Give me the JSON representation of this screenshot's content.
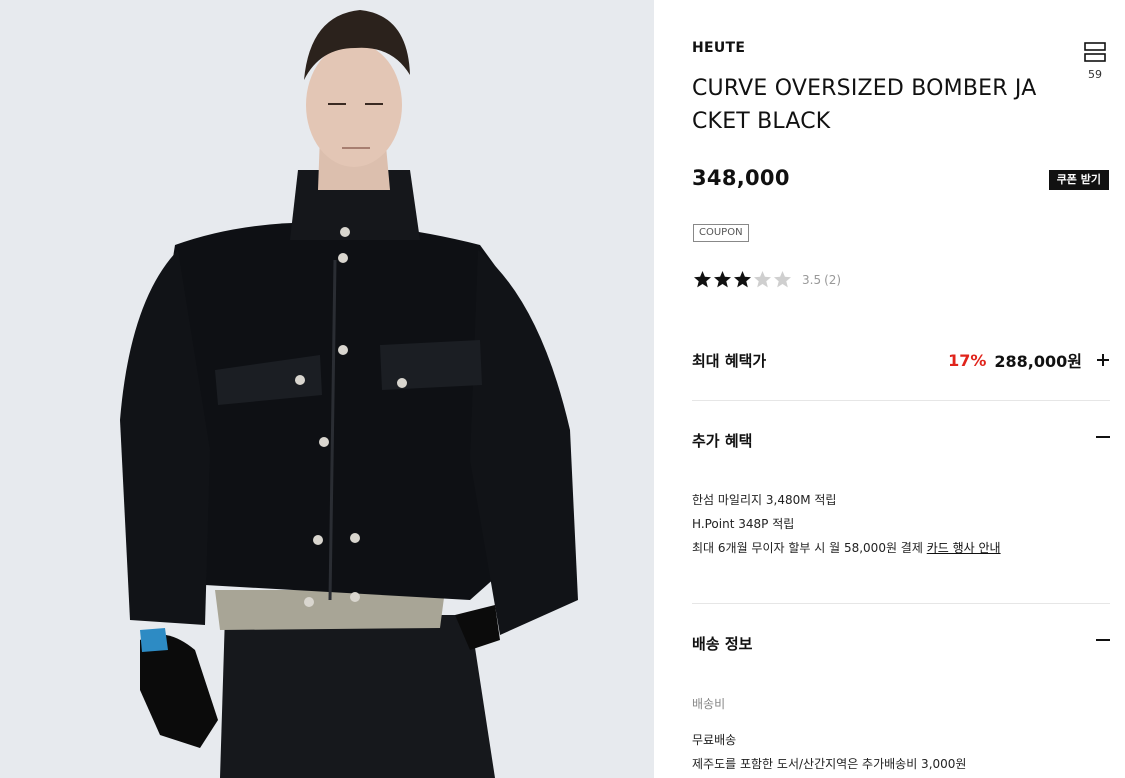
{
  "product": {
    "brand": "HEUTE",
    "title": "CURVE OVERSIZED BOMBER JACKET BLACK",
    "price": "348,000",
    "coupon_button": "쿠폰 받기",
    "coupon_badge": "COUPON",
    "bookmark_count": "59",
    "rating": {
      "score": "3.5",
      "count": "(2)",
      "stars_filled": 3,
      "stars_total": 5
    }
  },
  "max_benefit": {
    "label": "최대 혜택가",
    "discount": "17%",
    "price": "288,000원"
  },
  "extra_benefit": {
    "label": "추가 혜택",
    "lines": [
      "한섬 마일리지 3,480M 적립",
      "H.Point 348P 적립"
    ],
    "installment_text": "최대 6개월 무이자 할부 시 월 58,000원 결제",
    "installment_link": "카드 행사 안내"
  },
  "shipping": {
    "label": "배송 정보",
    "fee_label": "배송비",
    "free": "무료배송",
    "extra": "제주도를 포함한 도서/산간지역은 추가배송비 3,000원"
  },
  "colors": {
    "accent_red": "#e0241b",
    "text": "#111111",
    "photo_bg": "#e7eaee"
  },
  "icons": {
    "bookmark": "bookmark-icon",
    "star": "star-icon",
    "plus": "plus-icon",
    "minus": "minus-icon"
  }
}
